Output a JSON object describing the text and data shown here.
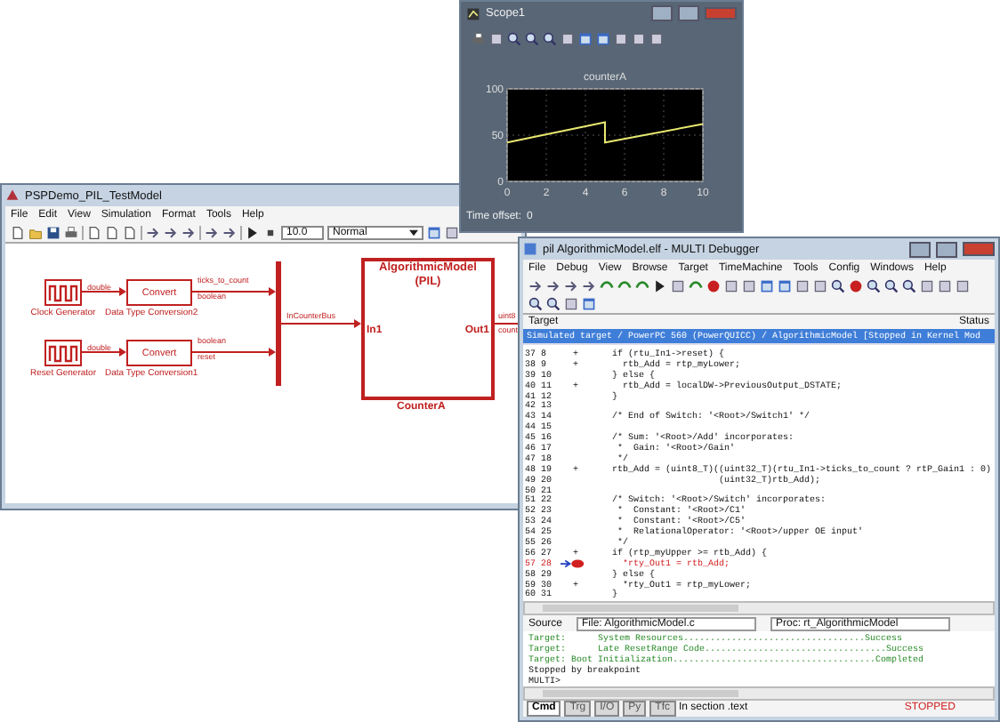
{
  "scope_window": {
    "title": "Scope1",
    "chart_data": {
      "type": "line",
      "title": "counterA",
      "x": [
        0,
        5,
        5,
        10
      ],
      "series": [
        {
          "color": "#e8e870",
          "values": [
            42,
            64,
            42,
            62
          ]
        }
      ],
      "xlim": [
        0,
        10
      ],
      "ylim": [
        0,
        100
      ],
      "xticks": [
        0,
        2,
        4,
        6,
        8,
        10
      ],
      "yticks": [
        0,
        50,
        100
      ],
      "grid": true
    },
    "time_offset": "Time offset:",
    "time_offset_value": "0"
  },
  "model_window": {
    "title": "PSPDemo_PIL_TestModel",
    "menu": [
      "File",
      "Edit",
      "View",
      "Simulation",
      "Format",
      "Tools",
      "Help"
    ],
    "stop_time": "10.0",
    "sim_mode": "Normal",
    "blocks": [
      {
        "kind": "pulse",
        "label": "Clock Generator"
      },
      {
        "kind": "pulse",
        "label": "Reset Generator"
      },
      {
        "kind": "convert",
        "text": "Convert",
        "label": "Data Type Conversion2"
      },
      {
        "kind": "convert",
        "text": "Convert",
        "label": "Data Type Conversion1"
      },
      {
        "kind": "bus"
      },
      {
        "kind": "subsystem",
        "title": "AlgorithmicModel",
        "subtitle": "(PIL)",
        "in_port": "In1",
        "out_port": "Out1",
        "label": "CounterA"
      }
    ],
    "signal_labels": [
      "double",
      "double",
      "ticks_to_count",
      "boolean",
      "boolean",
      "reset",
      "InCounterBus",
      "uint8",
      "count"
    ]
  },
  "debugger_window": {
    "title": "pil AlgorithmicModel.elf - MULTI Debugger",
    "menu": [
      "File",
      "Debug",
      "View",
      "Browse",
      "Target",
      "TimeMachine",
      "Tools",
      "Config",
      "Windows",
      "Help"
    ],
    "target_header": "Target",
    "status_header": "Status",
    "target_row": {
      "text": "Simulated target / PowerPC 560 (PowerQUICC) / AlgorithmicModel [Stopped in Kernel Mod",
      "selected": true
    },
    "code": [
      {
        "line": "37",
        "src": "8",
        "mark": "+",
        "text": "    if (rtu_In1->reset) {",
        "current": false
      },
      {
        "line": "38",
        "src": "9",
        "mark": "+",
        "text": "      rtb_Add = rtp_myLower;",
        "current": false
      },
      {
        "line": "39",
        "src": "10",
        "text": "    } else {",
        "current": false
      },
      {
        "line": "40",
        "src": "11",
        "mark": "+",
        "text": "      rtb_Add = localDW->PreviousOutput_DSTATE;",
        "current": false
      },
      {
        "line": "41",
        "src": "12",
        "text": "    }",
        "current": false
      },
      {
        "line": "42",
        "src": "13",
        "current": false
      },
      {
        "line": "43",
        "src": "14",
        "text": "    /* End of Switch: '<Root>/Switch1' */",
        "current": false
      },
      {
        "line": "44",
        "src": "15",
        "current": false
      },
      {
        "line": "45",
        "src": "16",
        "text": "    /* Sum: '<Root>/Add' incorporates:",
        "current": false
      },
      {
        "line": "46",
        "src": "17",
        "text": "     *  Gain: '<Root>/Gain'",
        "current": false
      },
      {
        "line": "47",
        "src": "18",
        "text": "     */",
        "current": false
      },
      {
        "line": "48",
        "src": "19",
        "mark": "+",
        "text": "    rtb_Add = (uint8_T)((uint32_T)(rtu_In1->ticks_to_count ? rtP_Gain1 : 0)",
        "current": false
      },
      {
        "line": "49",
        "src": "20",
        "text": "                        (uint32_T)rtb_Add);",
        "current": false
      },
      {
        "line": "50",
        "src": "21",
        "current": false
      },
      {
        "line": "51",
        "src": "22",
        "text": "    /* Switch: '<Root>/Switch' incorporates:",
        "current": false
      },
      {
        "line": "52",
        "src": "23",
        "text": "     *  Constant: '<Root>/C1'",
        "current": false
      },
      {
        "line": "53",
        "src": "24",
        "text": "     *  Constant: '<Root>/C5'",
        "current": false
      },
      {
        "line": "54",
        "src": "25",
        "text": "     *  RelationalOperator: '<Root>/upper OE input'",
        "current": false
      },
      {
        "line": "55",
        "src": "26",
        "text": "     */",
        "current": false
      },
      {
        "line": "56",
        "src": "27",
        "mark": "+",
        "text": "    if (rtp_myUpper >= rtb_Add) {",
        "current": false
      },
      {
        "line": "57",
        "src": "28",
        "text": "      *rty_Out1 = rtb_Add;",
        "current": true
      },
      {
        "line": "58",
        "src": "29",
        "text": "    } else {",
        "current": false
      },
      {
        "line": "59",
        "src": "30",
        "mark": "+",
        "text": "      *rty_Out1 = rtp_myLower;",
        "current": false
      },
      {
        "line": "60",
        "src": "31",
        "text": "    }",
        "current": false
      }
    ],
    "source_label": "Source",
    "file_label": "File:",
    "file": "AlgorithmicModel.c",
    "proc_label": "Proc:",
    "proc": "rt_AlgorithmicModel",
    "console": [
      "Target:      System Resources..................................Success",
      "Target:      Late ResetRange Code..................................Success",
      "Target: Boot Initialization......................................Completed",
      "Stopped by breakpoint",
      "MULTI>"
    ],
    "status_tabs": [
      {
        "label": "Cmd",
        "selected": true
      },
      {
        "label": "Trg",
        "selected": false
      },
      {
        "label": "I/O",
        "selected": false
      },
      {
        "label": "Py",
        "selected": false
      },
      {
        "label": "Tfc",
        "selected": false
      }
    ],
    "section": "In section .text",
    "state": "STOPPED"
  }
}
